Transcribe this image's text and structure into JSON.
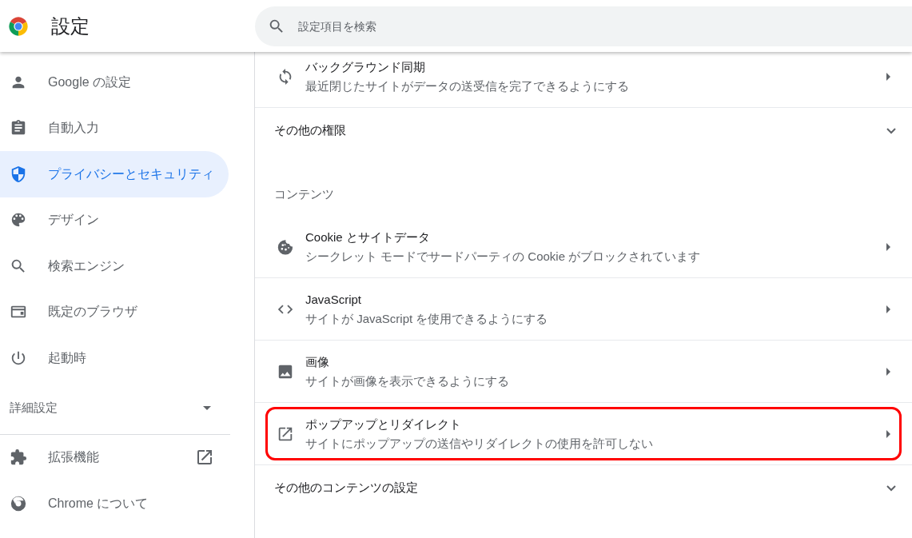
{
  "header": {
    "title": "設定",
    "search": {
      "placeholder": "設定項目を検索"
    }
  },
  "sidebar": {
    "items": [
      {
        "label": "Google の設定",
        "kind": "person",
        "selected": false
      },
      {
        "label": "自動入力",
        "kind": "clipboard",
        "selected": false
      },
      {
        "label": "プライバシーとセキュリティ",
        "kind": "shield",
        "selected": true
      },
      {
        "label": "デザイン",
        "kind": "palette",
        "selected": false
      },
      {
        "label": "検索エンジン",
        "kind": "search",
        "selected": false
      },
      {
        "label": "既定のブラウザ",
        "kind": "browser",
        "selected": false
      },
      {
        "label": "起動時",
        "kind": "power",
        "selected": false
      }
    ],
    "advanced": {
      "label": "詳細設定",
      "expanded": false
    },
    "footer_items": [
      {
        "label": "拡張機能",
        "kind": "puzzle",
        "external": true
      },
      {
        "label": "Chrome について",
        "kind": "chrome",
        "external": false
      }
    ]
  },
  "content": {
    "rows": [
      {
        "kind": "sync",
        "title": "バックグラウンド同期",
        "subtitle": "最近閉じたサイトがデータの送受信を完了できるようにする",
        "highlighted": false
      },
      {
        "kind": "expander",
        "title": "その他の権限",
        "expanded": false
      },
      {
        "kind": "heading",
        "title": "コンテンツ"
      },
      {
        "kind": "cookie",
        "title": "Cookie とサイトデータ",
        "subtitle": "シークレット モードでサードパーティの Cookie がブロックされています",
        "highlighted": false
      },
      {
        "kind": "code",
        "title": "JavaScript",
        "subtitle": "サイトが JavaScript を使用できるようにする",
        "highlighted": false
      },
      {
        "kind": "image",
        "title": "画像",
        "subtitle": "サイトが画像を表示できるようにする",
        "highlighted": false
      },
      {
        "kind": "popup",
        "title": "ポップアップとリダイレクト",
        "subtitle": "サイトにポップアップの送信やリダイレクトの使用を許可しない",
        "highlighted": true
      },
      {
        "kind": "expander",
        "title": "その他のコンテンツの設定",
        "expanded": false
      }
    ]
  }
}
